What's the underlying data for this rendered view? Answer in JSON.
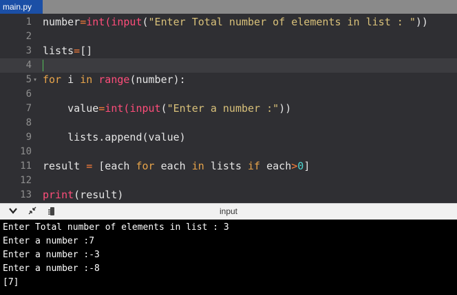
{
  "tab": {
    "filename": "main.py"
  },
  "editor": {
    "line_numbers": [
      "1",
      "2",
      "3",
      "4",
      "5",
      "6",
      "7",
      "8",
      "9",
      "10",
      "11",
      "12",
      "13"
    ],
    "line1": {
      "a": "number",
      "b": "=",
      "c": "int",
      "d": "(",
      "e": "input",
      "f": "(",
      "g": "\"Enter Total number of elements in list : \"",
      "h": "))"
    },
    "line3": {
      "a": "lists",
      "b": "=",
      "c": "[]"
    },
    "line5": {
      "a": "for",
      "b": " i ",
      "c": "in",
      "d": " ",
      "e": "range",
      "f": "(number):"
    },
    "line7": {
      "a": "    value",
      "b": "=",
      "c": "int",
      "d": "(",
      "e": "input",
      "f": "(",
      "g": "\"Enter a number :\"",
      "h": "))"
    },
    "line9": {
      "a": "    lists.append(value)"
    },
    "line11": {
      "a": "result ",
      "b": "=",
      "c": " [each ",
      "d": "for",
      "e": " each ",
      "f": "in",
      "g": " lists ",
      "h": "if",
      "i": " each",
      "j": ">",
      "k": "0",
      "l": "]"
    },
    "line13": {
      "a": "print",
      "b": "(result)"
    }
  },
  "input_panel": {
    "title": "input",
    "icons": [
      "chevron-down-icon",
      "collapse-arrows-icon",
      "clear-console-icon"
    ]
  },
  "console": {
    "lines": [
      "Enter Total number of elements in list : 3",
      "Enter a number :7",
      "Enter a number :-3",
      "Enter a number :-8",
      "[7]"
    ]
  },
  "colors": {
    "tab_bg": "#1b4fa6",
    "editor_bg": "#2f2f33",
    "keyword": "#e8a44a",
    "builtin": "#ff4d7a",
    "string": "#d9c17a",
    "number": "#4fd6d0"
  }
}
